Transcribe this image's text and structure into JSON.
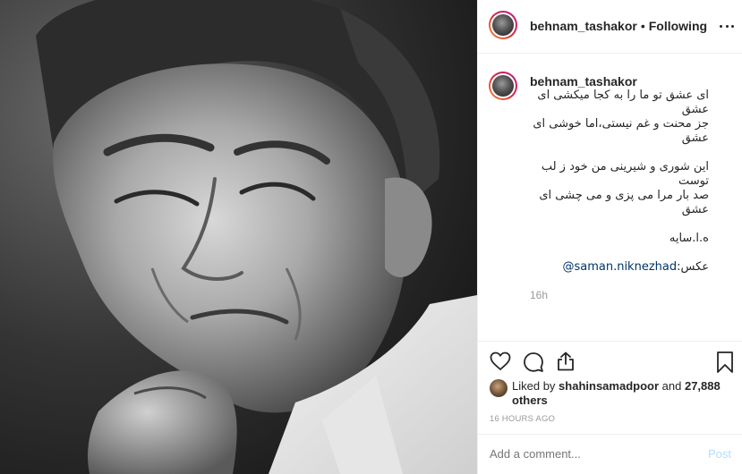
{
  "post": {
    "photo_alt": "Black and white portrait photo",
    "header": {
      "username": "behnam_tashakor",
      "separator": "•",
      "follow_status": "Following",
      "more_icon": "more-horizontal-icon"
    },
    "caption": {
      "username": "behnam_tashakor",
      "lines": [
        "ای عشق تو ما را به کجا میکشی ای",
        "عشق",
        "جز محنت و غم نیستی،اما خوشی ای",
        "عشق",
        "",
        "این شوری و شیرینی من خود ز لب",
        "توست",
        "صد بار مرا می پزی و می چشی ای",
        "عشق",
        "",
        "ه.ا.سایه",
        ""
      ],
      "credit_prefix": "عکس:",
      "credit_mention": "@saman.niknezhad",
      "age": "16h"
    },
    "actions": {
      "like_icon": "heart-icon",
      "comment_icon": "comment-bubble-icon",
      "share_icon": "share-upload-icon",
      "save_icon": "bookmark-icon"
    },
    "likes": {
      "prefix": "Liked by",
      "liker": "shahinsamadpoor",
      "connector": "and",
      "others": "27,888 others"
    },
    "posted_ago": "16 HOURS AGO",
    "add_comment": {
      "placeholder": "Add a comment...",
      "post_label": "Post"
    },
    "colors": {
      "link": "#003569",
      "muted": "#999999",
      "post_disabled": "#b2dffc"
    }
  }
}
